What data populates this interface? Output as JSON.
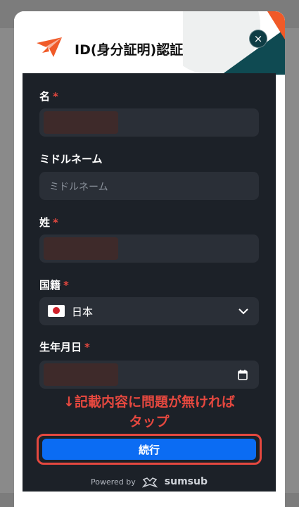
{
  "modal": {
    "title": "ID(身分証明)認証",
    "close_glyph": "×"
  },
  "form": {
    "fields": [
      {
        "label": "名",
        "required_mark": "*"
      },
      {
        "label": "ミドルネーム",
        "placeholder": "ミドルネーム"
      },
      {
        "label": "姓",
        "required_mark": "*"
      },
      {
        "label": "国籍",
        "required_mark": "*",
        "value": "日本"
      },
      {
        "label": "生年月日",
        "required_mark": "*"
      }
    ]
  },
  "annotation": {
    "line1": "↓記載内容に問題が無ければ",
    "line2": "タップ"
  },
  "continue_label": "続行",
  "footer": {
    "powered_by": "Powered by",
    "brand": "sumsub"
  },
  "colors": {
    "accent_orange": "#f05a28",
    "primary_blue": "#0b6cf3",
    "annotation_red": "#e5483f",
    "panel_bg": "#1c2128"
  },
  "icons": {
    "logo": "brand-arrow-icon",
    "close": "close-icon",
    "country": "japan-flag-icon",
    "dropdown": "chevron-down-icon",
    "date": "calendar-icon",
    "sumsub": "sumsub-icon"
  }
}
